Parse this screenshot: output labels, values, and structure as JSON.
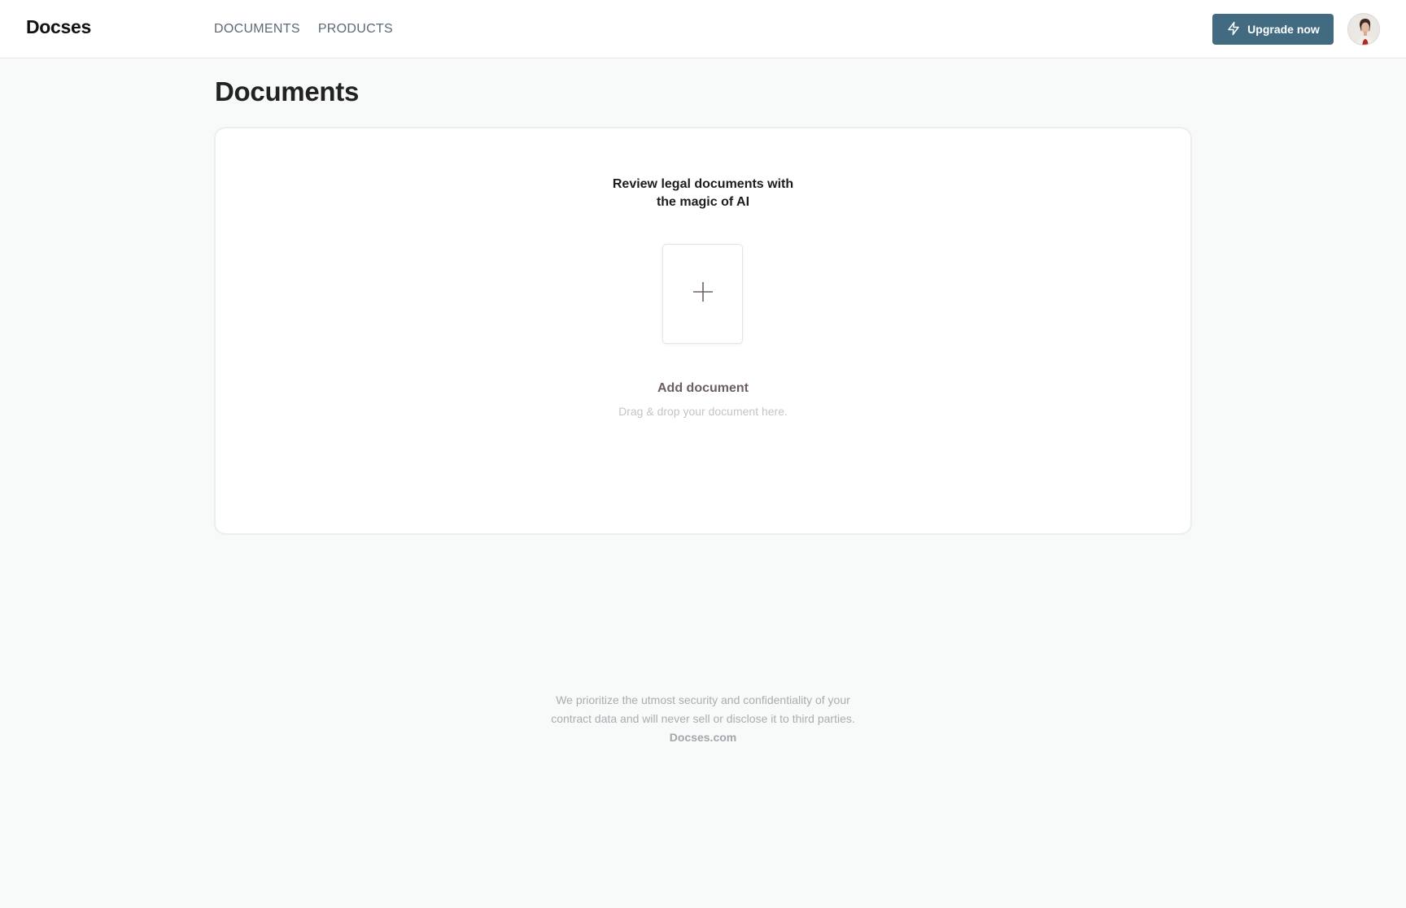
{
  "header": {
    "brand": "Docses",
    "nav": [
      "DOCUMENTS",
      "PRODUCTS"
    ],
    "upgrade_label": "Upgrade now",
    "upgrade_icon": "lightning-bolt-icon",
    "accent_color": "#426b82"
  },
  "page": {
    "title": "Documents"
  },
  "upload_card": {
    "headline_line1": "Review legal documents with",
    "headline_line2": "the magic of AI",
    "add_icon": "plus-icon",
    "add_label": "Add document",
    "add_sub": "Drag & drop your document here."
  },
  "footer": {
    "line1": "We prioritize the utmost security and confidentiality of your",
    "line2": "contract data and will never sell or disclose it to third parties.",
    "domain": "Docses.com"
  }
}
